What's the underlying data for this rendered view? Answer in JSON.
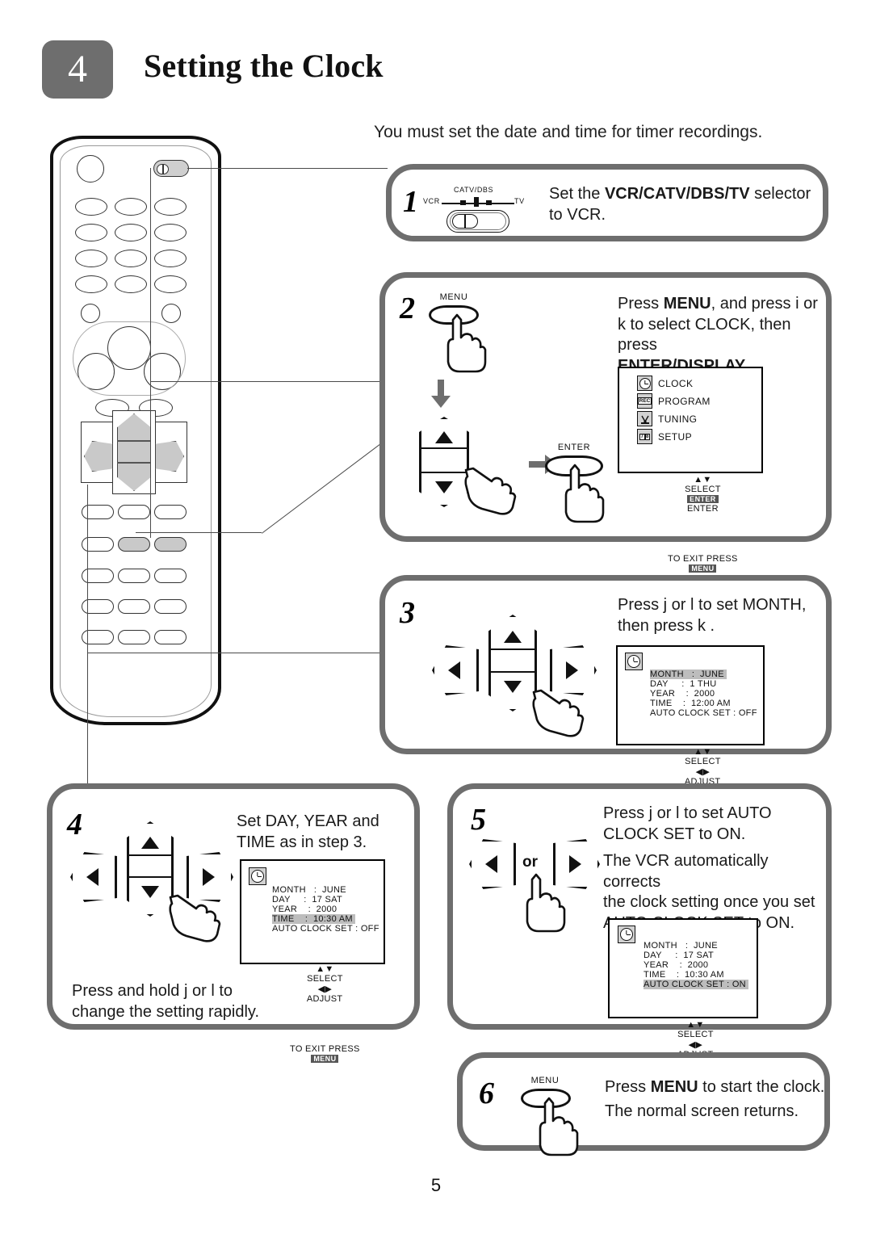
{
  "header": {
    "badge_number": "4",
    "title": "Setting the Clock"
  },
  "intro": "You must set the date and time for timer recordings.",
  "page_number": "5",
  "selector": {
    "label_left": "VCR",
    "label_center": "CATV/DBS",
    "label_right": "TV"
  },
  "steps": [
    {
      "number": "1",
      "text_prefix": "Set the ",
      "text_bold": "VCR/CATV/DBS/TV",
      "text_suffix": " selector to VCR."
    },
    {
      "number": "2",
      "button_label": "MENU",
      "enter_label": "ENTER",
      "line1_a": "Press ",
      "line1_b": "MENU",
      "line1_c": ", and press i   or",
      "line2": "k  to select CLOCK, then press",
      "line3_bold": "ENTER/DISPLAY",
      "line3_tail": "."
    },
    {
      "number": "3",
      "line1": "Press j   or l   to set MONTH,",
      "line2": "then press k ."
    },
    {
      "number": "4",
      "line1": "Set DAY, YEAR and",
      "line2": "TIME as in step 3.",
      "note1": "Press and hold j   or l   to",
      "note2": "change the setting rapidly."
    },
    {
      "number": "5",
      "or_label": "or",
      "line1": "Press j   or l   to set AUTO",
      "line2": "CLOCK SET to ON.",
      "line3": "The VCR automatically corrects",
      "line4": "the clock setting once you set",
      "line5": "AUTO CLOCK SET to ON."
    },
    {
      "number": "6",
      "button_label": "MENU",
      "line1_a": "Press ",
      "line1_b": "MENU",
      "line1_c": " to start the clock.",
      "line2": "The normal screen returns."
    }
  ],
  "osd_main_menu": {
    "items": [
      {
        "icon": "clock-icon",
        "label": "CLOCK"
      },
      {
        "icon": "rec-icon",
        "label": "PROGRAM"
      },
      {
        "icon": "tuning-icon",
        "label": "TUNING"
      },
      {
        "icon": "setup-icon",
        "label": "SETUP"
      }
    ],
    "icon_text": {
      "rec": "REC",
      "setup_a": "7",
      "setup_b": "8"
    },
    "foot_select": "SELECT",
    "foot_enter_key": "ENTER",
    "foot_enter_word": "ENTER",
    "foot_exit": "TO EXIT PRESS",
    "foot_menu_key": "MENU"
  },
  "osd_clock_step3": {
    "rows": [
      {
        "label": "MONTH",
        "sep": ":",
        "value": "JUNE",
        "highlight": true
      },
      {
        "label": "DAY",
        "sep": ":",
        "value": "1 THU",
        "highlight": false
      },
      {
        "label": "YEAR",
        "sep": ":",
        "value": "2000",
        "highlight": false
      },
      {
        "label": "TIME",
        "sep": ":",
        "value": "12:00 AM",
        "highlight": false
      }
    ],
    "auto_label": "AUTO CLOCK SET",
    "auto_sep": ":",
    "auto_value": "OFF",
    "auto_highlight": false,
    "foot_select": "SELECT",
    "foot_adjust": "ADJUST",
    "foot_exit": "TO EXIT PRESS",
    "foot_menu_key": "MENU"
  },
  "osd_clock_step4": {
    "rows": [
      {
        "label": "MONTH",
        "sep": ":",
        "value": "JUNE",
        "highlight": false
      },
      {
        "label": "DAY",
        "sep": ":",
        "value": "17 SAT",
        "highlight": false
      },
      {
        "label": "YEAR",
        "sep": ":",
        "value": "2000",
        "highlight": false
      },
      {
        "label": "TIME",
        "sep": ":",
        "value": "10:30 AM",
        "highlight": true
      }
    ],
    "auto_label": "AUTO CLOCK SET",
    "auto_sep": ":",
    "auto_value": "OFF",
    "auto_highlight": false,
    "foot_select": "SELECT",
    "foot_adjust": "ADJUST",
    "foot_exit": "TO EXIT PRESS",
    "foot_menu_key": "MENU"
  },
  "osd_clock_step5": {
    "rows": [
      {
        "label": "MONTH",
        "sep": ":",
        "value": "JUNE",
        "highlight": false
      },
      {
        "label": "DAY",
        "sep": ":",
        "value": "17 SAT",
        "highlight": false
      },
      {
        "label": "YEAR",
        "sep": ":",
        "value": "2000",
        "highlight": false
      },
      {
        "label": "TIME",
        "sep": ":",
        "value": "10:30 AM",
        "highlight": false
      }
    ],
    "auto_label": "AUTO CLOCK SET",
    "auto_sep": ":",
    "auto_value": "ON",
    "auto_highlight": true,
    "foot_select": "SELECT",
    "foot_adjust": "ADJUST",
    "foot_exit": "TO EXIT PRESS",
    "foot_menu_key": "MENU"
  },
  "colors": {
    "accent_gray": "#6e6e6e",
    "highlight": "#bdbdbd",
    "key_chip": "#555555"
  }
}
